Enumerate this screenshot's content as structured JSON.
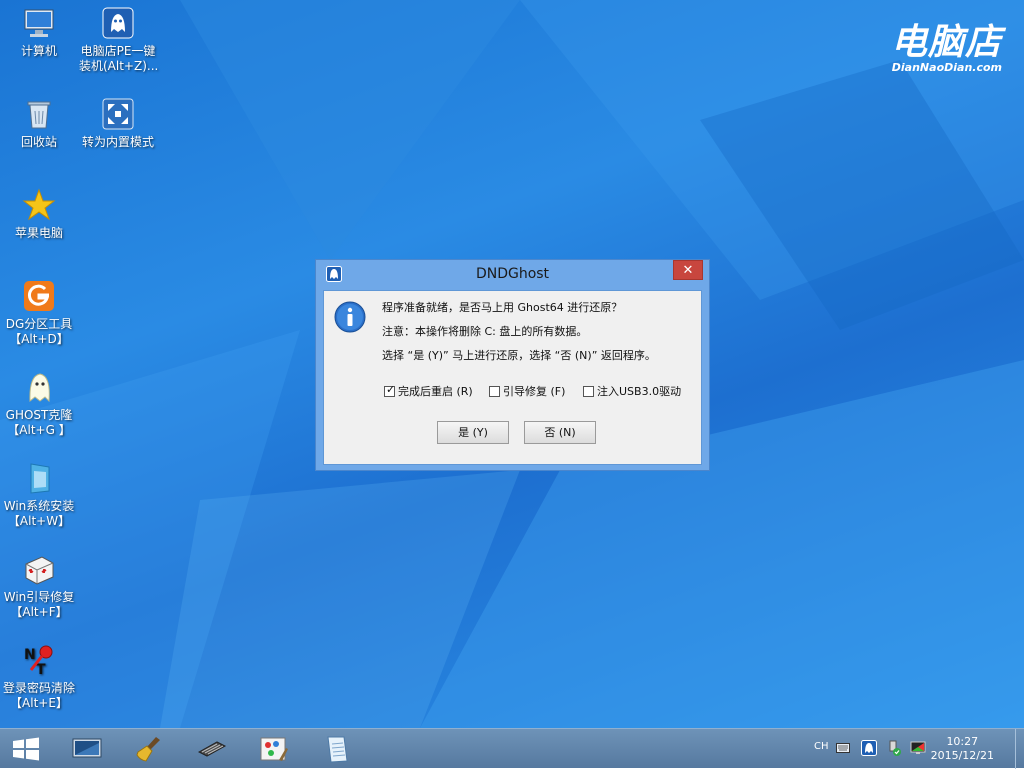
{
  "desktop": {
    "icons": [
      {
        "line1": "计算机",
        "line2": ""
      },
      {
        "line1": "电脑店PE一键",
        "line2": "装机(Alt+Z)..."
      },
      {
        "line1": "回收站",
        "line2": ""
      },
      {
        "line1": "转为内置模式",
        "line2": ""
      },
      {
        "line1": "苹果电脑",
        "line2": ""
      },
      {
        "line1": "DG分区工具",
        "line2": "【Alt+D】"
      },
      {
        "line1": "GHOST克隆",
        "line2": "【Alt+G 】"
      },
      {
        "line1": "Win系统安装",
        "line2": "【Alt+W】"
      },
      {
        "line1": "Win引导修复",
        "line2": "【Alt+F】"
      },
      {
        "line1": "登录密码清除",
        "line2": "【Alt+E】"
      }
    ]
  },
  "brand": {
    "name": "电脑店",
    "url": "DianNaoDian.com"
  },
  "dialog": {
    "title": "DNDGhost",
    "close_glyph": "✕",
    "messages": [
      "程序准备就绪，是否马上用 Ghost64 进行还原？",
      "注意：本操作将删除 C: 盘上的所有数据。",
      "选择 “是 (Y)” 马上进行还原，选择 “否 (N)” 返回程序。"
    ],
    "options": [
      {
        "label": "完成后重启 (R)",
        "checked": true
      },
      {
        "label": "引导修复 (F)",
        "checked": false
      },
      {
        "label": "注入USB3.0驱动",
        "checked": false
      }
    ],
    "yes_label": "是 (Y)",
    "no_label": "否 (N)"
  },
  "taskbar": {
    "items": [
      "start-icon",
      "screen-icon",
      "broom-icon",
      "memory-icon",
      "paint-icon",
      "notepad-icon"
    ],
    "tray": {
      "ime": "CH",
      "time": "10:27",
      "date": "2015/12/21"
    }
  },
  "colors": {
    "desktop": "#2a8be4",
    "dialog_frame": "#6fa8e8",
    "close": "#c8463e"
  }
}
